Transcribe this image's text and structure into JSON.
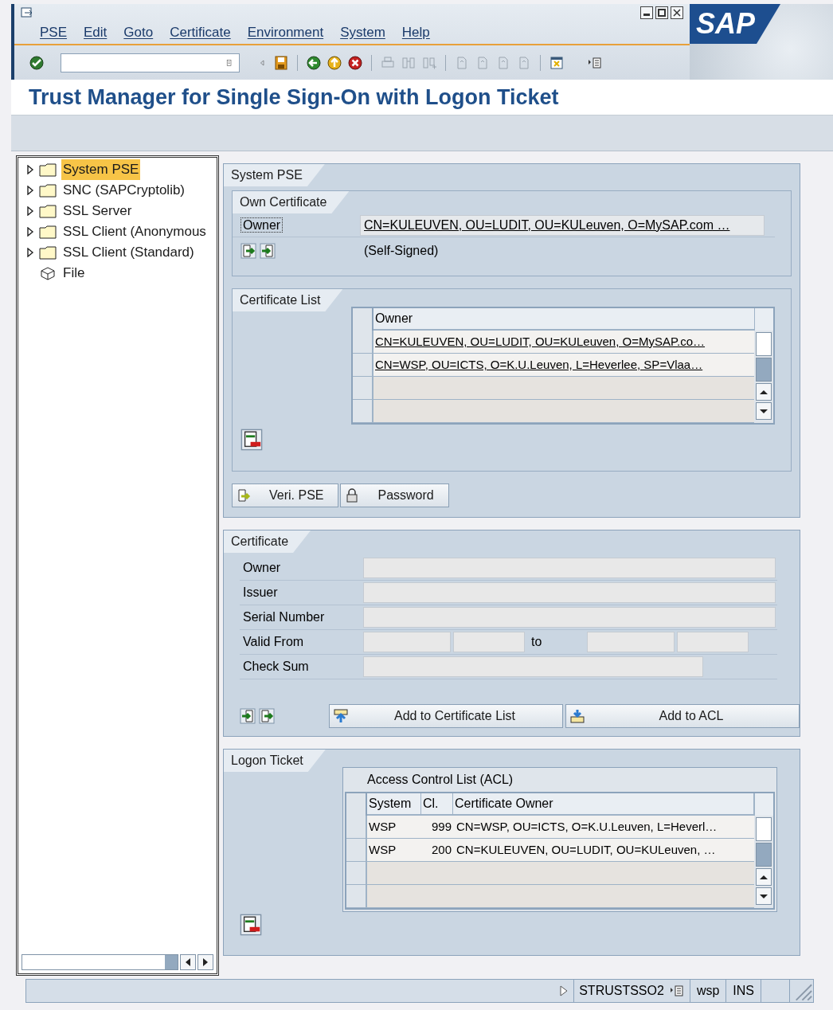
{
  "window": {
    "logo": "SAP",
    "menu": [
      "PSE",
      "Edit",
      "Goto",
      "Certificate",
      "Environment",
      "System",
      "Help"
    ]
  },
  "title": "Trust Manager for Single Sign-On with Logon Ticket",
  "tree": {
    "items": [
      {
        "label": "System PSE",
        "kind": "folder",
        "selected": true
      },
      {
        "label": "SNC (SAPCryptolib)",
        "kind": "folder",
        "selected": false
      },
      {
        "label": "SSL Server",
        "kind": "folder",
        "selected": false
      },
      {
        "label": "SSL Client (Anonymous",
        "kind": "folder",
        "selected": false
      },
      {
        "label": "SSL Client (Standard)",
        "kind": "folder",
        "selected": false
      },
      {
        "label": "File",
        "kind": "file",
        "selected": false
      }
    ]
  },
  "system_pse": {
    "title": "System PSE",
    "own_certificate": {
      "title": "Own Certificate",
      "owner_label": "Owner",
      "owner_focused": true,
      "owner_value": "CN=KULEUVEN, OU=LUDIT, OU=KULeuven, O=MySAP.com …",
      "note": "(Self-Signed)"
    },
    "certificate_list": {
      "title": "Certificate List",
      "column": "Owner",
      "rows": [
        "CN=KULEUVEN, OU=LUDIT, OU=KULeuven, O=MySAP.co…",
        "CN=WSP, OU=ICTS, O=K.U.Leuven, L=Heverlee, SP=Vlaa…"
      ]
    },
    "buttons": [
      {
        "label": "Veri. PSE",
        "kind": "verify"
      },
      {
        "label": "Password",
        "kind": "lock"
      }
    ]
  },
  "certificate": {
    "title": "Certificate",
    "fields": [
      {
        "label": "Owner",
        "kind": "long"
      },
      {
        "label": "Issuer",
        "kind": "long"
      },
      {
        "label": "Serial Number",
        "kind": "long"
      },
      {
        "label": "Valid From",
        "kind": "range",
        "separator": "to"
      },
      {
        "label": "Check Sum",
        "kind": "short"
      }
    ],
    "buttons": [
      {
        "label": "Add to Certificate List",
        "kind": "add-list"
      },
      {
        "label": "Add to ACL",
        "kind": "add-acl"
      }
    ]
  },
  "logon_ticket": {
    "title": "Logon Ticket",
    "acl": {
      "title": "Access Control List (ACL)",
      "columns": [
        "System",
        "Cl.",
        "Certificate Owner"
      ],
      "rows": [
        [
          "WSP",
          "999",
          "CN=WSP, OU=ICTS, O=K.U.Leuven, L=Heverl…"
        ],
        [
          "WSP",
          "200",
          "CN=KULEUVEN, OU=LUDIT, OU=KULeuven, …"
        ]
      ]
    }
  },
  "status_bar": {
    "transaction": "STRUSTSSO2",
    "client": "wsp",
    "mode": "INS"
  }
}
